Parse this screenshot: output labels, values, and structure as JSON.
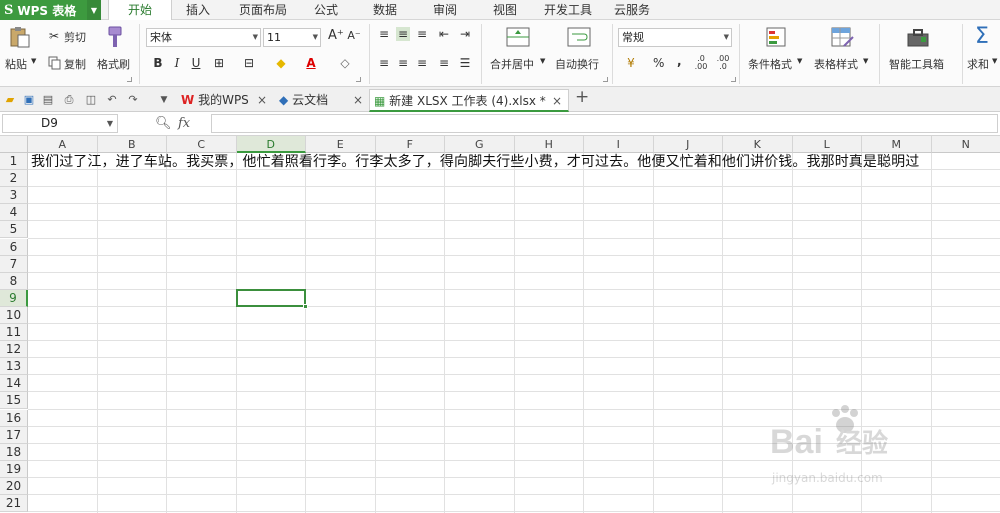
{
  "app": {
    "brand": "WPS 表格",
    "logo_letter": "S"
  },
  "menu": {
    "tabs": [
      {
        "label": "开始",
        "active": true
      },
      {
        "label": "插入"
      },
      {
        "label": "页面布局"
      },
      {
        "label": "公式"
      },
      {
        "label": "数据"
      },
      {
        "label": "审阅"
      },
      {
        "label": "视图"
      },
      {
        "label": "开发工具"
      },
      {
        "label": "云服务"
      }
    ]
  },
  "ribbon": {
    "paste": "粘贴",
    "cut": "剪切",
    "copy": "复制",
    "format_painter": "格式刷",
    "font_name": "宋体",
    "font_size": "11",
    "merge_center": "合并居中",
    "wrap_text": "自动换行",
    "number_format": "常规",
    "percent": "%",
    "comma": ",",
    "cond_format": "条件格式",
    "table_style": "表格样式",
    "smart_toolbox": "智能工具箱",
    "sum": "求和"
  },
  "tabs": {
    "items": [
      {
        "label": "我的WPS",
        "close": "×"
      },
      {
        "label": "云文档",
        "close": "×"
      },
      {
        "label": "新建 XLSX 工作表 (4).xlsx *",
        "close": "×",
        "active": true
      }
    ],
    "add": "+"
  },
  "formula_bar": {
    "name_box": "D9",
    "fx": "fx",
    "content": ""
  },
  "sheet": {
    "columns": [
      "A",
      "B",
      "C",
      "D",
      "E",
      "F",
      "G",
      "H",
      "I",
      "J",
      "K",
      "L",
      "M",
      "N"
    ],
    "rows": [
      "1",
      "2",
      "3",
      "4",
      "5",
      "6",
      "7",
      "8",
      "9",
      "10",
      "11",
      "12",
      "13",
      "14",
      "15",
      "16",
      "17",
      "18",
      "19",
      "20",
      "21"
    ],
    "selected_cell": "D9",
    "a1": "我们过了江，进了车站。我买票，他忙着照看行李。行李太多了，得向脚夫行些小费，才可过去。他便又忙着和他们讲价钱。我那时真是聪明过"
  },
  "watermark": {
    "brand": "Bai",
    "brand2": "经验",
    "url": "jingyan.baidu.com"
  }
}
